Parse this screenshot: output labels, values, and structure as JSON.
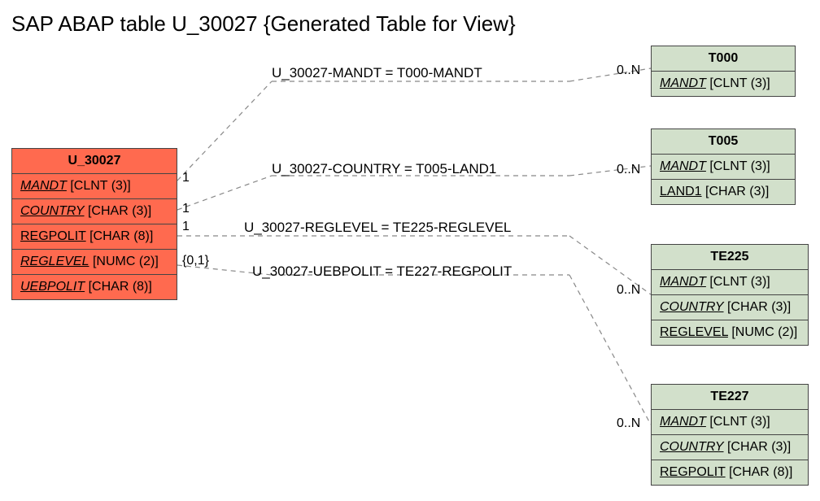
{
  "title": "SAP ABAP table U_30027 {Generated Table for View}",
  "main_entity": {
    "name": "U_30027",
    "fields": [
      {
        "field": "MANDT",
        "type": "[CLNT (3)]",
        "italic": true
      },
      {
        "field": "COUNTRY",
        "type": "[CHAR (3)]",
        "italic": true
      },
      {
        "field": "REGPOLIT",
        "type": "[CHAR (8)]",
        "italic": false
      },
      {
        "field": "REGLEVEL",
        "type": "[NUMC (2)]",
        "italic": true
      },
      {
        "field": "UEBPOLIT",
        "type": "[CHAR (8)]",
        "italic": true
      }
    ]
  },
  "related": [
    {
      "name": "T000",
      "fields": [
        {
          "field": "MANDT",
          "type": "[CLNT (3)]",
          "italic": true
        }
      ]
    },
    {
      "name": "T005",
      "fields": [
        {
          "field": "MANDT",
          "type": "[CLNT (3)]",
          "italic": true
        },
        {
          "field": "LAND1",
          "type": "[CHAR (3)]",
          "italic": false
        }
      ]
    },
    {
      "name": "TE225",
      "fields": [
        {
          "field": "MANDT",
          "type": "[CLNT (3)]",
          "italic": true
        },
        {
          "field": "COUNTRY",
          "type": "[CHAR (3)]",
          "italic": true
        },
        {
          "field": "REGLEVEL",
          "type": "[NUMC (2)]",
          "italic": false
        }
      ]
    },
    {
      "name": "TE227",
      "fields": [
        {
          "field": "MANDT",
          "type": "[CLNT (3)]",
          "italic": true
        },
        {
          "field": "COUNTRY",
          "type": "[CHAR (3)]",
          "italic": true
        },
        {
          "field": "REGPOLIT",
          "type": "[CHAR (8)]",
          "italic": false
        }
      ]
    }
  ],
  "relations": [
    {
      "label": "U_30027-MANDT = T000-MANDT",
      "left_card": "1",
      "right_card": "0..N"
    },
    {
      "label": "U_30027-COUNTRY = T005-LAND1",
      "left_card": "1",
      "right_card": "0..N"
    },
    {
      "label": "U_30027-REGLEVEL = TE225-REGLEVEL",
      "left_card": "1",
      "right_card": "0..N"
    },
    {
      "label": "U_30027-UEBPOLIT = TE227-REGPOLIT",
      "left_card": "{0,1}",
      "right_card": "0..N"
    }
  ]
}
